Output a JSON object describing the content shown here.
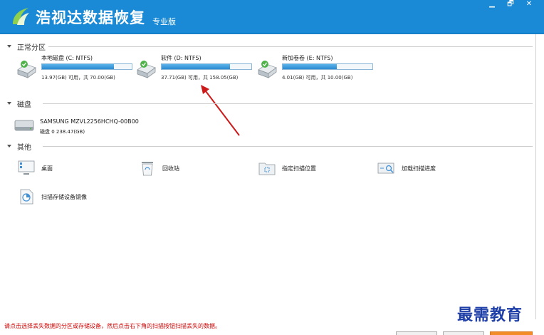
{
  "app": {
    "title": "浩视达数据恢复",
    "edition": "专业版",
    "controls": {
      "minimize": "▁",
      "restore": "🗗",
      "close": "✕"
    }
  },
  "sections": {
    "partitions": "正常分区",
    "disks": "磁盘",
    "others": "其他"
  },
  "drives": [
    {
      "name": "本地磁盘 (C: NTFS)",
      "usage": "13.97(GB) 可用，共 70.00(GB)",
      "used_fraction": 0.8
    },
    {
      "name": "软件 (D: NTFS)",
      "usage": "37.71(GB) 可用，共 158.05(GB)",
      "used_fraction": 0.76
    },
    {
      "name": "新加卷卷 (E: NTFS)",
      "usage": "4.01(GB) 可用，共 10.00(GB)",
      "used_fraction": 0.6
    }
  ],
  "disk": {
    "name": "SAMSUNG MZVL2256HCHQ-00B00",
    "info": "磁盘 0    238.47(GB)"
  },
  "tools": {
    "desktop": "桌面",
    "recycle_bin": "回收站",
    "scan_location": "指定扫描位置",
    "load_progress": "加载扫描进度",
    "scan_image": "扫描存储设备镜像"
  },
  "status_text": "请点击选择丢失数据的分区或存储设备，然后点击右下角的扫描按钮扫描丢失的数据。",
  "watermark": "最需教育",
  "colors": {
    "titlebar": "#1a8ad6",
    "bar_fill": "#2b8ad0",
    "status": "#d20000",
    "arrow": "#cc1a1a"
  }
}
